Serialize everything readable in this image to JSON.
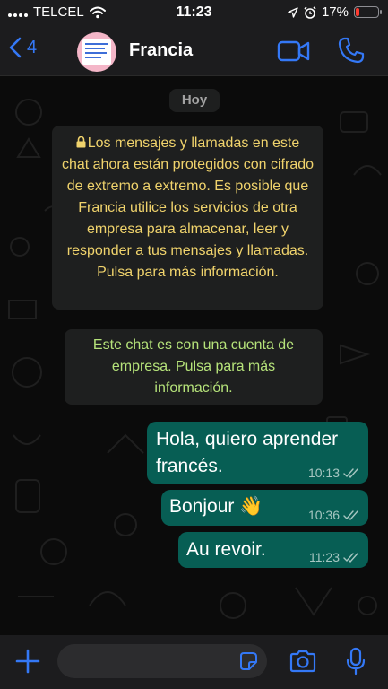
{
  "status_bar": {
    "carrier": "TELCEL",
    "time": "11:23",
    "battery": "17%",
    "battery_level": 0.17,
    "battery_color": "#ff3b30"
  },
  "header": {
    "back_count": "4",
    "contact_name": "Francia",
    "accent": "#3478f6",
    "icons": [
      "chevron-left-icon",
      "video-camera-icon",
      "phone-icon"
    ]
  },
  "chat": {
    "date_label": "Hoy",
    "e2e_notice": "Los mensajes y llamadas en este chat ahora están protegidos con cifrado de extremo a extremo. Es posible que Francia utilice los servicios de otra empresa para almacenar, leer y responder a tus mensajes y llamadas. Pulsa para más información.",
    "business_notice": "Este chat es con una cuenta de empresa. Pulsa para más información.",
    "messages": [
      {
        "text": "Hola, quiero aprender francés.",
        "time": "10:13",
        "status": "read"
      },
      {
        "text": "Bonjour 👋",
        "time": "10:36",
        "status": "read"
      },
      {
        "text": "Au revoir.",
        "time": "11:23",
        "status": "read"
      }
    ],
    "bubble_color": "#075e54"
  },
  "input_bar": {
    "placeholder": "",
    "icons": [
      "plus-icon",
      "sticker-icon",
      "camera-icon",
      "microphone-icon"
    ]
  }
}
